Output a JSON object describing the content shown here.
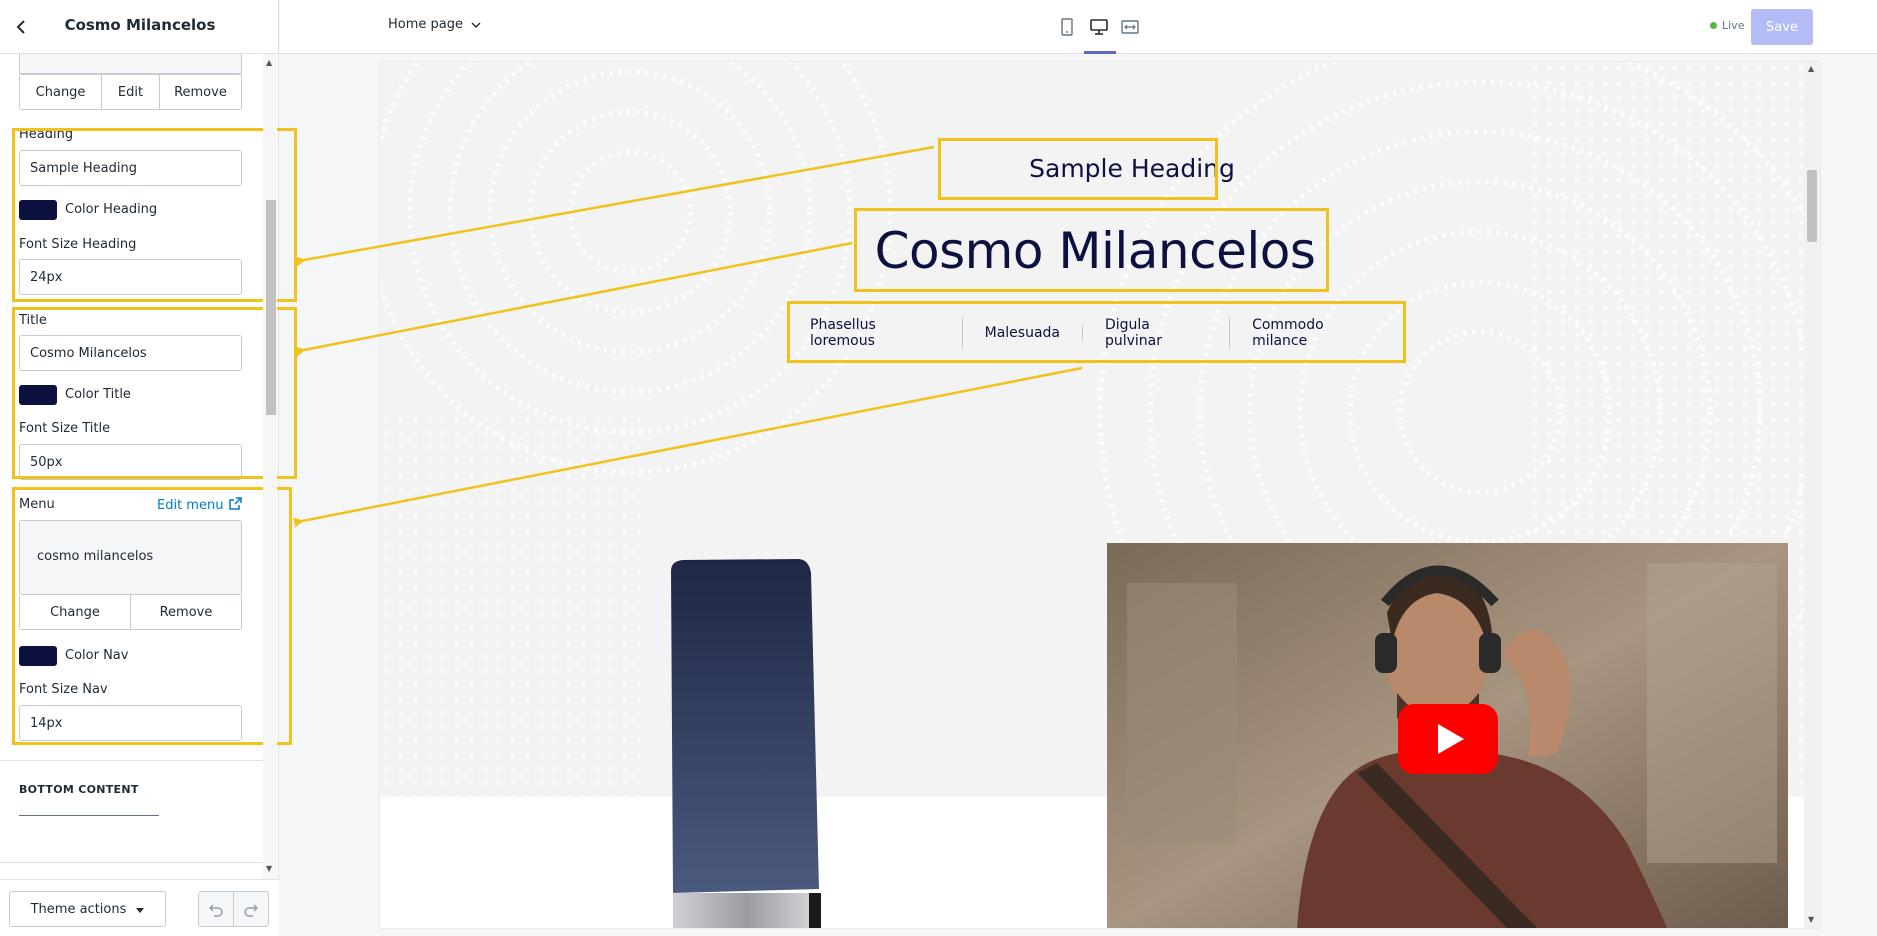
{
  "sidebar": {
    "title": "Cosmo Milancelos",
    "image_buttons": [
      "Change",
      "Edit",
      "Remove"
    ],
    "heading": {
      "label": "Heading",
      "value": "Sample Heading",
      "color_label": "Color Heading",
      "font_size_label": "Font Size Heading",
      "font_size_value": "24px"
    },
    "title_field": {
      "label": "Title",
      "value": "Cosmo Milancelos",
      "color_label": "Color Title",
      "font_size_label": "Font Size Title",
      "font_size_value": "50px"
    },
    "menu": {
      "label": "Menu",
      "edit_link": "Edit menu",
      "selected": "cosmo milancelos",
      "buttons": [
        "Change",
        "Remove"
      ],
      "color_label": "Color Nav",
      "font_size_label": "Font Size Nav",
      "font_size_value": "14px"
    },
    "bottom_section": "BOTTOM CONTENT",
    "theme_actions": "Theme actions"
  },
  "topbar": {
    "page_select": "Home page",
    "status": "Live",
    "save_label": "Save"
  },
  "preview": {
    "heading": "Sample Heading",
    "title": "Cosmo Milancelos",
    "nav": [
      "Phasellus loremous",
      "Malesuada",
      "Digula pulvinar",
      "Commodo milance"
    ]
  },
  "colors": {
    "heading": "#0d1140",
    "title": "#0d1140",
    "nav": "#0d1140",
    "annotation": "#f1c21b",
    "accent": "#5c6ac4"
  }
}
